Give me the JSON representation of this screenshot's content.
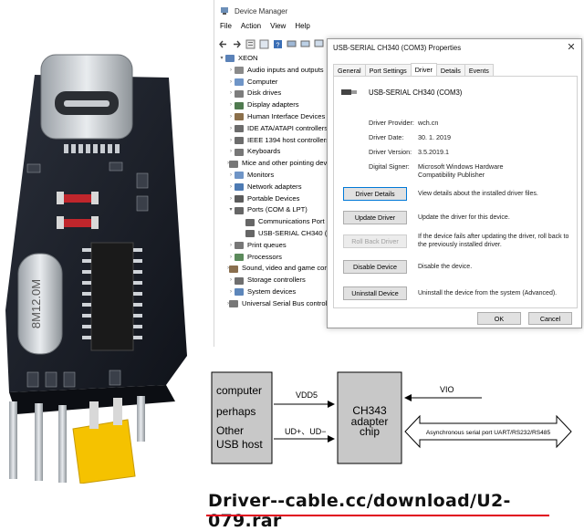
{
  "device_manager": {
    "title": "Device Manager",
    "menu": [
      "File",
      "Action",
      "View",
      "Help"
    ],
    "tree": [
      {
        "label": "XEON",
        "level": 0,
        "expanded": true,
        "icon": "computer-icon"
      },
      {
        "label": "Audio inputs and outputs",
        "level": 1,
        "icon": "speaker-icon"
      },
      {
        "label": "Computer",
        "level": 1,
        "icon": "monitor-icon"
      },
      {
        "label": "Disk drives",
        "level": 1,
        "icon": "disk-icon"
      },
      {
        "label": "Display adapters",
        "level": 1,
        "icon": "display-adapter-icon"
      },
      {
        "label": "Human Interface Devices",
        "level": 1,
        "icon": "hid-icon"
      },
      {
        "label": "IDE ATA/ATAPI controllers",
        "level": 1,
        "icon": "ide-icon"
      },
      {
        "label": "IEEE 1394 host controllers",
        "level": 1,
        "icon": "firewire-icon"
      },
      {
        "label": "Keyboards",
        "level": 1,
        "icon": "keyboard-icon"
      },
      {
        "label": "Mice and other pointing devices",
        "level": 1,
        "icon": "mouse-icon"
      },
      {
        "label": "Monitors",
        "level": 1,
        "icon": "monitor-icon"
      },
      {
        "label": "Network adapters",
        "level": 1,
        "icon": "network-icon"
      },
      {
        "label": "Portable Devices",
        "level": 1,
        "icon": "portable-device-icon"
      },
      {
        "label": "Ports (COM & LPT)",
        "level": 1,
        "expanded": true,
        "icon": "port-icon"
      },
      {
        "label": "Communications Port (COM1)",
        "level": 2,
        "icon": "port-icon"
      },
      {
        "label": "USB-SERIAL CH340 (COM3)",
        "level": 2,
        "icon": "port-icon"
      },
      {
        "label": "Print queues",
        "level": 1,
        "icon": "printer-icon"
      },
      {
        "label": "Processors",
        "level": 1,
        "icon": "processor-icon"
      },
      {
        "label": "Sound, video and game controllers",
        "level": 1,
        "icon": "sound-icon"
      },
      {
        "label": "Storage controllers",
        "level": 1,
        "icon": "storage-icon"
      },
      {
        "label": "System devices",
        "level": 1,
        "icon": "system-icon"
      },
      {
        "label": "Universal Serial Bus controllers",
        "level": 1,
        "icon": "usb-icon"
      }
    ]
  },
  "properties_dialog": {
    "title": "USB-SERIAL CH340 (COM3) Properties",
    "close_glyph": "✕",
    "tabs": [
      "General",
      "Port Settings",
      "Driver",
      "Details",
      "Events"
    ],
    "active_tab": "Driver",
    "device_name": "USB-SERIAL CH340 (COM3)",
    "info": [
      {
        "key": "Driver Provider:",
        "value": "wch.cn"
      },
      {
        "key": "Driver Date:",
        "value": "30. 1. 2019"
      },
      {
        "key": "Driver Version:",
        "value": "3.5.2019.1"
      },
      {
        "key": "Digital Signer:",
        "value": "Microsoft Windows Hardware Compatibility Publisher"
      }
    ],
    "actions": [
      {
        "label": "Driver Details",
        "desc": "View details about the installed driver files."
      },
      {
        "label": "Update Driver",
        "desc": "Update the driver for this device."
      },
      {
        "label": "Roll Back Driver",
        "desc": "If the device fails after updating the driver, roll back to the previously installed driver."
      },
      {
        "label": "Disable Device",
        "desc": "Disable the device."
      },
      {
        "label": "Uninstall Device",
        "desc": "Uninstall the device from the system (Advanced)."
      }
    ],
    "ok_label": "OK",
    "cancel_label": "Cancel"
  },
  "board_photo": {
    "crystal_marking": "8M12.0M"
  },
  "diagram": {
    "host_lines": [
      "computer",
      "perhaps",
      "Other",
      "USB host"
    ],
    "vdd_label": "VDD5",
    "usb_label": "UD+、UD−",
    "chip_lines": [
      "CH343",
      "adapter",
      "chip"
    ],
    "vio_label": "VIO",
    "serial_label": "Asynchronous serial port UART/RS232/RS485"
  },
  "footer": {
    "url": "Driver--cable.cc/download/U2-079.rar"
  },
  "colors": {
    "accent_blue": "#0078d7",
    "diagram_gray": "#c8c8c8",
    "url_underline": "#e0001b",
    "pcb": "#1c2029",
    "jumper": "#f5c200"
  }
}
